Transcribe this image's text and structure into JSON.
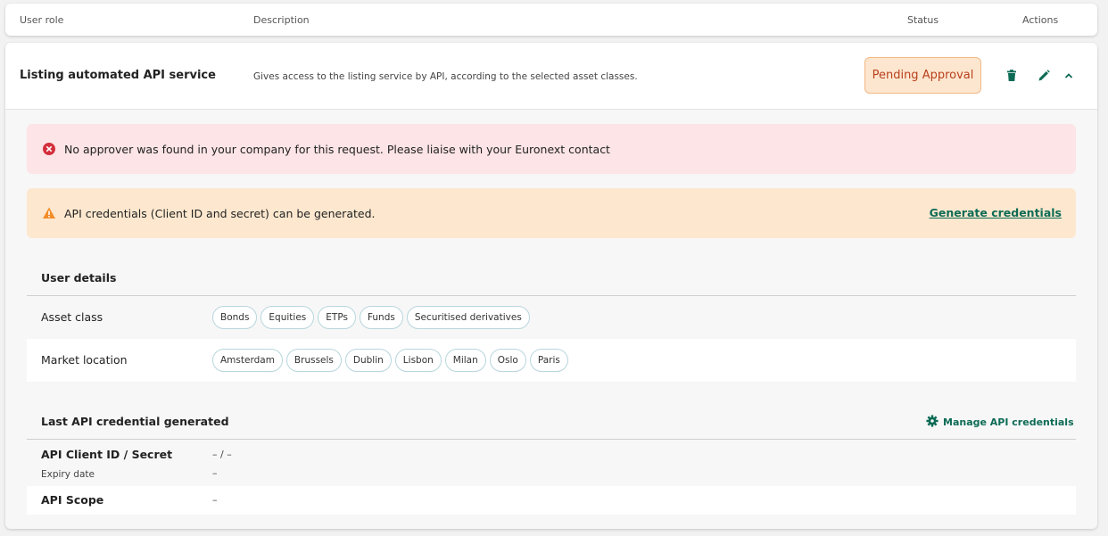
{
  "table_header": {
    "user_role": "User role",
    "description": "Description",
    "status": "Status",
    "actions": "Actions"
  },
  "role": {
    "title": "Listing automated API service",
    "description": "Gives access to the listing service by API, according to the selected asset classes.",
    "status": "Pending Approval",
    "actions": [
      "trash-icon",
      "pencil-icon",
      "chevron-up-icon"
    ]
  },
  "alerts": {
    "error_text": "No approver was found in your company for this request. Please liaise with your Euronext contact",
    "warning_text": "API credentials (Client ID and secret) can be generated.",
    "generate_link": "Generate credentials"
  },
  "user_details": {
    "title": "User details",
    "asset_class_label": "Asset class",
    "asset_classes": [
      "Bonds",
      "Equities",
      "ETPs",
      "Funds",
      "Securitised derivatives"
    ],
    "market_location_label": "Market location",
    "market_locations": [
      "Amsterdam",
      "Brussels",
      "Dublin",
      "Lisbon",
      "Milan",
      "Oslo",
      "Paris"
    ]
  },
  "credentials": {
    "title": "Last API credential generated",
    "manage_label": "Manage API credentials",
    "client_id_label": "API Client ID / Secret",
    "client_id_value": "– / –",
    "expiry_label": "Expiry date",
    "expiry_value": "–",
    "scope_label": "API Scope",
    "scope_value": "–"
  },
  "colors": {
    "accent": "#0d6b55",
    "status_bg": "#fde6cf",
    "status_text": "#b8401c",
    "error_bg": "#fde4e6",
    "warning_bg": "#fde8cf"
  }
}
